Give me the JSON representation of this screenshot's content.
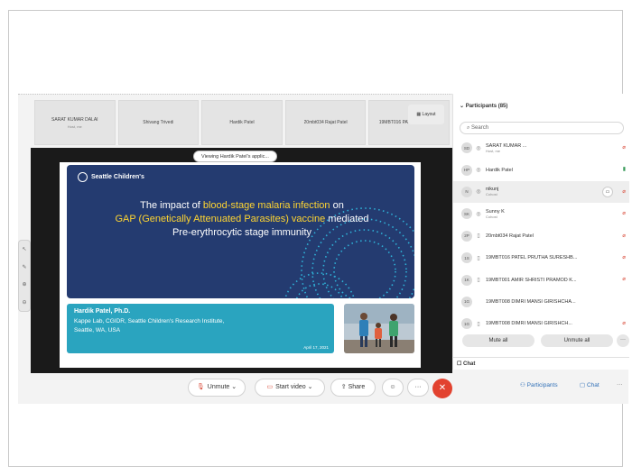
{
  "video_strip": [
    {
      "name": "SARAT KUMAR DALAI",
      "sub": "Host, me"
    },
    {
      "name": "Shivang Trivedi",
      "sub": ""
    },
    {
      "name": "Hardik Patel",
      "sub": ""
    },
    {
      "name": "20mbt034 Rajat Patel",
      "sub": ""
    },
    {
      "name": "19MBT016 PATEL PRUTHA...",
      "sub": ""
    }
  ],
  "layout_label": "Layout",
  "viewing_label": "Viewing Hardik Patel's applic...",
  "slide": {
    "org": "Seattle Children's",
    "title_l1_a": "The impact of ",
    "title_l1_hl": "blood-stage malaria infection",
    "title_l1_b": " on",
    "title_l2_hl": "GAP (Genetically Attenuated Parasites) vaccine",
    "title_l2_b": " mediated",
    "title_l3": "Pre-erythrocytic stage immunity",
    "presenter": "Hardik Patel, Ph.D.",
    "affiliation_l1": "Kappe Lab, CGIDR, Seattle Children's Research Institute,",
    "affiliation_l2": "Seattle, WA, USA",
    "date": "April 17, 2021"
  },
  "participants": {
    "header": "Participants (85)",
    "search_placeholder": "Search",
    "items": [
      {
        "initials": "SD",
        "name": "SARAT KUMAR ...",
        "sub": "Host, me",
        "mic": "off"
      },
      {
        "initials": "HP",
        "name": "Hardik Patel",
        "sub": "",
        "mic": "on"
      },
      {
        "initials": "N",
        "name": "nikunj",
        "sub": "Cohost",
        "mic": "off"
      },
      {
        "initials": "SK",
        "name": "Sunny K",
        "sub": "Cohost",
        "mic": "off"
      },
      {
        "initials": "2P",
        "name": "20mbt034 Rajat Patel",
        "sub": "",
        "mic": "off"
      },
      {
        "initials": "1S",
        "name": "19MBT016 PATEL PRUTHA SURESHB...",
        "sub": "",
        "mic": "off"
      },
      {
        "initials": "1K",
        "name": "19MBT001 AMIR SHRISTI PRAMOD K...",
        "sub": "",
        "mic": "off"
      },
      {
        "initials": "1G",
        "name": "19MBT008 DIMRI MANSI GIRISHCHA...",
        "sub": "",
        "mic": "off"
      },
      {
        "initials": "1G",
        "name": "19MBT008 DIMRI MANSI GIRISHCH...",
        "sub": "",
        "mic": "off"
      }
    ],
    "mute_all": "Mute all",
    "unmute_all": "Unmute all"
  },
  "chat_label": "Chat",
  "controls": {
    "unmute": "Unmute",
    "start_video": "Start video",
    "share": "Share",
    "participants": "Participants",
    "chat": "Chat"
  },
  "colors": {
    "slide_bg": "#243b70",
    "accent": "#ffd531",
    "presenter_bg": "#2aa4bf",
    "end": "#e2422f"
  }
}
